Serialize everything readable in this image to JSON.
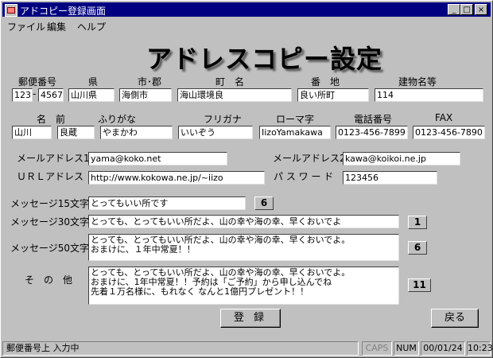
{
  "window": {
    "title": "アドコピー登録画面",
    "min": "_",
    "max": "□",
    "close": "×"
  },
  "menu": [
    "ファイル",
    "編集",
    "ヘルプ"
  ],
  "form_title": "アドレスコピー設定",
  "row1": {
    "labels": [
      "郵便番号",
      "県",
      "市･郡",
      "町　名",
      "番　地",
      "建物名等"
    ],
    "zip1": "123",
    "zip_sep": "-",
    "zip2": "4567",
    "pref": "山川県",
    "city": "海側市",
    "town": "海山環境良",
    "banchi": "良い所町",
    "building": "114"
  },
  "row2": {
    "labels": [
      "名　前",
      "ふりがな",
      "フリガナ",
      "ローマ字",
      "電話番号",
      "FAX"
    ],
    "name_last": "山川",
    "name_first": "良蔵",
    "furigana": "やまかわ",
    "furigana_kana": "いいぞう",
    "romaji": "IizoYamakawa",
    "phone": "0123-456-7899",
    "fax": "0123-456-7890"
  },
  "email": {
    "label1": "メールアドレス1",
    "value1": "yama@koko.net",
    "label2": "メールアドレス2",
    "value2": "kawa@koikoi.ne.jp"
  },
  "url": {
    "label": "ＵＲＬアドレス",
    "value": "http://www.kokowa.ne.jp/~iizo",
    "pw_label": "パ ス ワ ー ド",
    "pw_value": "123456"
  },
  "messages": {
    "m15_label": "メッセージ15文字",
    "m15_value": "とってもいい所です",
    "m15_count": "6",
    "m30_label": "メッセージ30文字",
    "m30_value": "とっても、とってもいい所だよ、山の幸や海の幸、早くおいでよ",
    "m30_count": "1",
    "m50_label": "メッセージ50文字",
    "m50_lines": [
      "とっても、とってもいい所だよ、山の幸や海の幸、早くおいでよ。",
      "おまけに、１年中常夏！！"
    ],
    "m50_count": "6",
    "other_label": "そ　の　他",
    "other_lines": [
      "とっても、とってもいい所だよ、山の幸や海の幸、早くおいでよ。",
      "おまけに、1年中常夏！！予約は「ご予約」から申し込んでね",
      "先着１万名様に、もれなく なんと1億円プレゼント！！"
    ],
    "other_count": "11"
  },
  "buttons": {
    "register": "登 録",
    "back": "戻る"
  },
  "status": {
    "message": "郵便番号上 入力中",
    "caps": "CAPS",
    "num": "NUM",
    "date": "00/01/24",
    "time": "10:23"
  }
}
